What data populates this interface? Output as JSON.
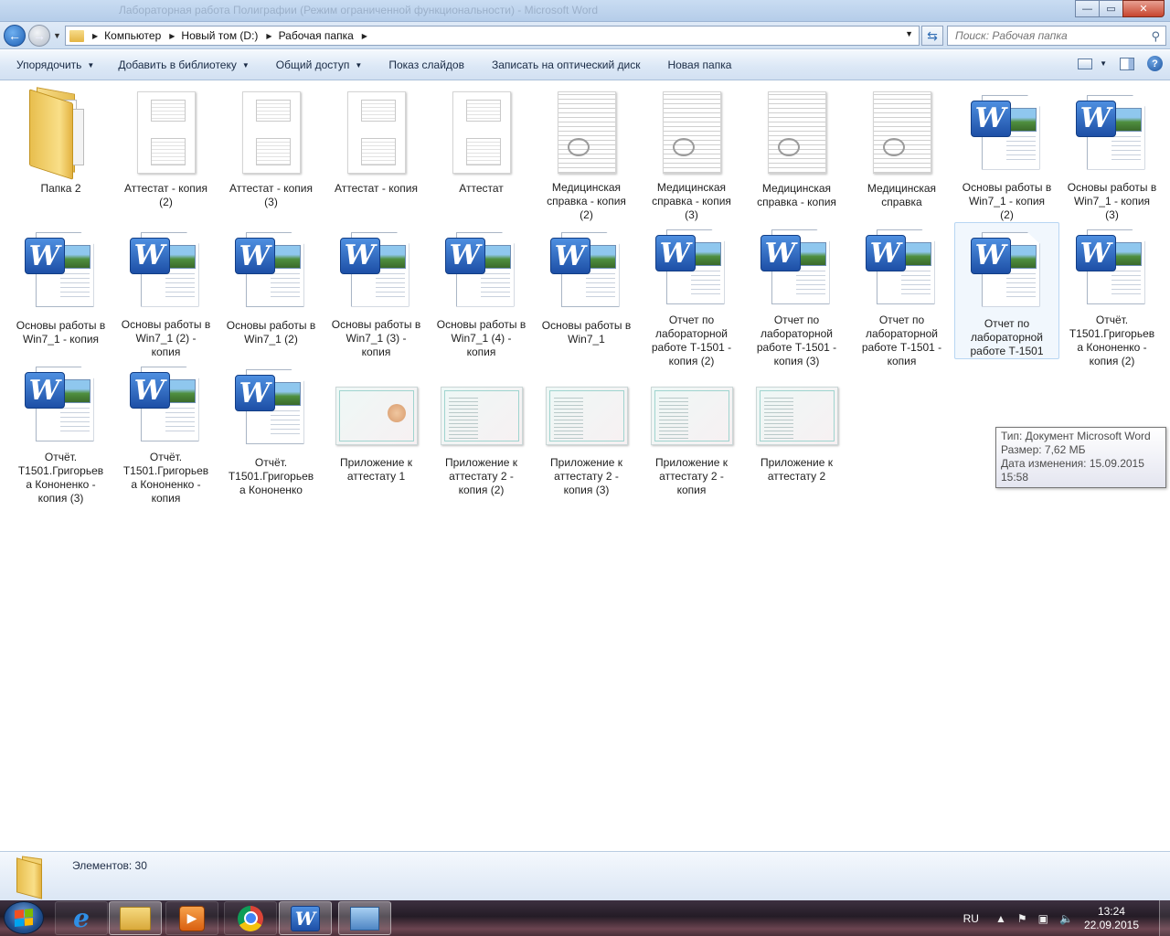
{
  "window": {
    "title_ghost": "Лабораторная работа Полиграфии (Режим ограниченной функциональности) - Microsoft Word",
    "minimize": "—",
    "maximize": "▭",
    "close": "✕"
  },
  "address": {
    "crumbs": [
      "Компьютер",
      "Новый том (D:)",
      "Рабочая папка"
    ],
    "search_placeholder": "Поиск: Рабочая папка"
  },
  "toolbar": {
    "organize": "Упорядочить",
    "add_to_library": "Добавить в библиотеку",
    "share": "Общий доступ",
    "slideshow": "Показ слайдов",
    "burn": "Записать на оптический диск",
    "new_folder": "Новая папка"
  },
  "files": [
    {
      "name": "Папка 2",
      "type": "folder"
    },
    {
      "name": "Аттестат - копия (2)",
      "type": "cert"
    },
    {
      "name": "Аттестат - копия (3)",
      "type": "cert"
    },
    {
      "name": "Аттестат - копия",
      "type": "cert"
    },
    {
      "name": "Аттестат",
      "type": "cert"
    },
    {
      "name": "Медицинская справка - копия (2)",
      "type": "med"
    },
    {
      "name": "Медицинская справка - копия (3)",
      "type": "med"
    },
    {
      "name": "Медицинская справка - копия",
      "type": "med"
    },
    {
      "name": "Медицинская справка",
      "type": "med"
    },
    {
      "name": "Основы работы в Win7_1 - копия (2)",
      "type": "word"
    },
    {
      "name": "Основы работы в Win7_1 - копия (3)",
      "type": "word"
    },
    {
      "name": "Основы работы в Win7_1 - копия",
      "type": "word"
    },
    {
      "name": "Основы работы в Win7_1 (2) - копия",
      "type": "word"
    },
    {
      "name": "Основы работы в Win7_1 (2)",
      "type": "word"
    },
    {
      "name": "Основы работы в Win7_1 (3) - копия",
      "type": "word"
    },
    {
      "name": "Основы работы в Win7_1 (4) - копия",
      "type": "word"
    },
    {
      "name": "Основы работы в Win7_1",
      "type": "word"
    },
    {
      "name": "Отчет по лабораторной работе Т-1501 - копия (2)",
      "type": "word"
    },
    {
      "name": "Отчет по лабораторной работе Т-1501 - копия (3)",
      "type": "word"
    },
    {
      "name": "Отчет по лабораторной работе Т-1501 - копия",
      "type": "word"
    },
    {
      "name": "Отчет по лабораторной работе Т-1501",
      "type": "word",
      "selected": true
    },
    {
      "name": "Отчёт. Т1501.Григорьев а Кононенко - копия (2)",
      "type": "word"
    },
    {
      "name": "Отчёт. Т1501.Григорьев а Кононенко - копия (3)",
      "type": "word"
    },
    {
      "name": "Отчёт. Т1501.Григорьев а Кононенко - копия",
      "type": "word"
    },
    {
      "name": "Отчёт. Т1501.Григорьев а Кононенко",
      "type": "word"
    },
    {
      "name": "Приложение к аттестату 1",
      "type": "app1"
    },
    {
      "name": "Приложение к аттестату 2 - копия (2)",
      "type": "app2"
    },
    {
      "name": "Приложение к аттестату 2 - копия (3)",
      "type": "app2"
    },
    {
      "name": "Приложение к аттестату 2 - копия",
      "type": "app2"
    },
    {
      "name": "Приложение к аттестату 2",
      "type": "app2"
    }
  ],
  "tooltip": {
    "type_line": "Тип: Документ Microsoft Word",
    "size_line": "Размер: 7,62 МБ",
    "date_line": "Дата изменения: 15.09.2015 15:58"
  },
  "details": {
    "count": "Элементов: 30"
  },
  "taskbar": {
    "lang": "RU",
    "time": "13:24",
    "date": "22.09.2015"
  }
}
